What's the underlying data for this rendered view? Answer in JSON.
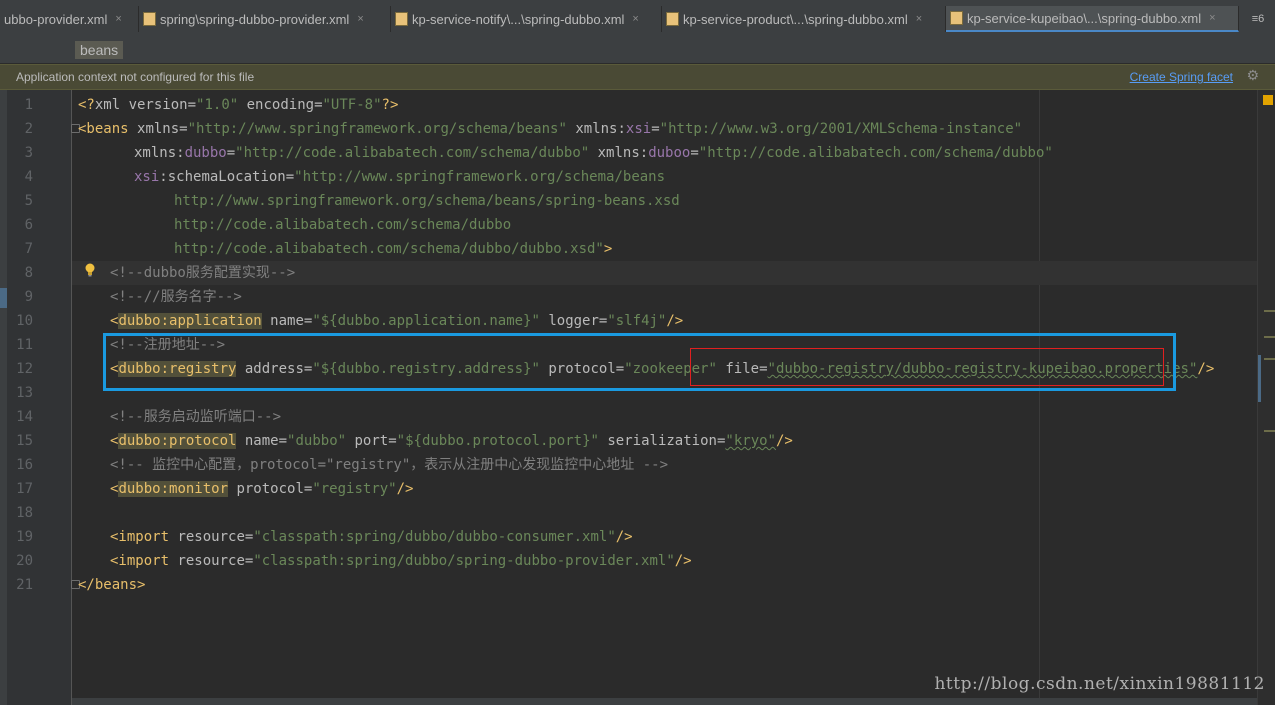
{
  "tabs": [
    {
      "label": "ubbo-provider.xml",
      "active": false
    },
    {
      "label": "spring\\spring-dubbo-provider.xml",
      "active": false
    },
    {
      "label": "kp-service-notify\\...\\spring-dubbo.xml",
      "active": false
    },
    {
      "label": "kp-service-product\\...\\spring-dubbo.xml",
      "active": false
    },
    {
      "label": "kp-service-kupeibao\\...\\spring-dubbo.xml",
      "active": true
    }
  ],
  "tab_close_glyph": "×",
  "tab_menu_label": "≡6",
  "breadcrumb": "beans",
  "notification": {
    "text": "Application context not configured for this file",
    "link": "Create Spring facet"
  },
  "line_numbers": [
    "1",
    "2",
    "3",
    "4",
    "5",
    "6",
    "7",
    "8",
    "9",
    "10",
    "11",
    "12",
    "13",
    "14",
    "15",
    "16",
    "17",
    "18",
    "19",
    "20",
    "21"
  ],
  "code": {
    "l1": {
      "a": "<?",
      "b": "xml ",
      "c": "version",
      "d": "=",
      "e": "\"1.0\"",
      "f": " ",
      "g": "encoding",
      "h": "=",
      "i": "\"UTF-8\"",
      "j": "?>"
    },
    "l2": {
      "a": "<beans ",
      "b": "xmlns",
      "c": "=",
      "d": "\"http://www.springframework.org/schema/beans\"",
      "e": " xmlns:",
      "f": "xsi",
      "g": "=",
      "h": "\"http://www.w3.org/2001/XMLSchema-instance\""
    },
    "l3": {
      "a": "xmlns:",
      "b": "dubbo",
      "c": "=",
      "d": "\"http://code.alibabatech.com/schema/dubbo\"",
      "e": " xmlns:",
      "f": "duboo",
      "g": "=",
      "h": "\"http://code.alibabatech.com/schema/dubbo\""
    },
    "l4": {
      "a": "xsi",
      "b": ":schemaLocation",
      "c": "=",
      "d": "\"http://www.springframework.org/schema/beans"
    },
    "l5": "http://www.springframework.org/schema/beans/spring-beans.xsd",
    "l6": "http://code.alibabatech.com/schema/dubbo",
    "l7": {
      "a": "http://code.alibabatech.com/schema/dubbo/dubbo.xsd\"",
      "b": ">"
    },
    "l8": "<!--dubbo服务配置实现-->",
    "l9": "<!--//服务名字-->",
    "l10": {
      "a": "<",
      "b": "dubbo:application",
      "c": " name",
      "d": "=",
      "e": "\"${dubbo.application.name}\"",
      "f": " logger",
      "g": "=",
      "h": "\"slf4j\"",
      "i": "/>"
    },
    "l11": "<!--注册地址-->",
    "l12": {
      "a": "<",
      "b": "dubbo:registry",
      "c": " address",
      "d": "=",
      "e": "\"${dubbo.registry.address}\"",
      "f": " protocol",
      "g": "=",
      "h": "\"zookeeper\"",
      "i": " file",
      "j": "=",
      "k": "\"dubbo-registry/dubbo-registry-kupeibao.properties\"",
      "l": "/>"
    },
    "l14": "<!--服务启动监听端口-->",
    "l15": {
      "a": "<",
      "b": "dubbo:protocol",
      "c": " name",
      "d": "=",
      "e": "\"dubbo\"",
      "f": " port",
      "g": "=",
      "h": "\"${dubbo.protocol.port}\"",
      "i": " serialization",
      "j": "=",
      "k": "\"kryo\"",
      "l": "/>"
    },
    "l16": "<!-- 监控中心配置，protocol=\"registry\"，表示从注册中心发现监控中心地址 -->",
    "l17": {
      "a": "<",
      "b": "dubbo:monitor",
      "c": " protocol",
      "d": "=",
      "e": "\"registry\"",
      "f": "/>"
    },
    "l19": {
      "a": "<import ",
      "b": "resource",
      "c": "=",
      "d": "\"classpath:spring/dubbo/dubbo-consumer.xml\"",
      "e": "/>"
    },
    "l20": {
      "a": "<import ",
      "b": "resource",
      "c": "=",
      "d": "\"classpath:spring/dubbo/spring-dubbo-provider.xml\"",
      "e": "/>"
    },
    "l21": "</beans>"
  },
  "watermark": "http://blog.csdn.net/xinxin19881112",
  "colors": {
    "accent_blue_box": "#1a9ae0",
    "red_box": "#e02020",
    "tag": "#e8bf6a",
    "value": "#6a8759",
    "namespace": "#9876aa",
    "comment": "#808080",
    "link": "#589df6"
  },
  "icons": {
    "tab_file": "xml-file-icon",
    "close": "close-icon",
    "gear": "gear-icon",
    "bulb": "lightbulb-icon",
    "fold": "fold-icon"
  }
}
